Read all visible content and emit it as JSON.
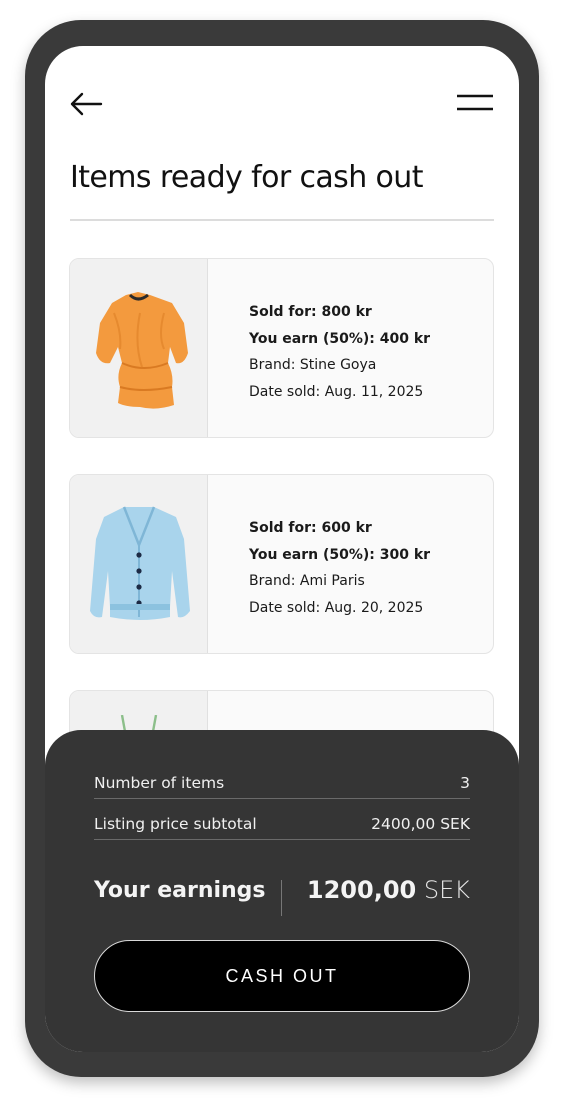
{
  "header": {
    "title": "Items ready for cash out",
    "back_icon": "arrow-left-icon",
    "menu_icon": "hamburger-menu-icon"
  },
  "items": [
    {
      "image": "orange-blouse",
      "sold_for": "Sold for: 800 kr",
      "you_earn": "You earn (50%): 400 kr",
      "brand": "Brand: Stine Goya",
      "date_sold": "Date sold: Aug. 11, 2025"
    },
    {
      "image": "blue-cardigan",
      "sold_for": "Sold for: 600 kr",
      "you_earn": "You earn (50%): 300 kr",
      "brand": "Brand: Ami Paris",
      "date_sold": "Date sold: Aug. 20, 2025"
    },
    {
      "image": "green-garment"
    }
  ],
  "summary": {
    "number_of_items_label": "Number of items",
    "number_of_items_value": "3",
    "subtotal_label": "Listing price subtotal",
    "subtotal_value": "2400,00 SEK",
    "earnings_label": "Your earnings",
    "earnings_amount": "1200,00",
    "earnings_currency": "SEK",
    "cash_out_label": "CASH OUT"
  },
  "colors": {
    "frame": "#3a3a3a",
    "summary_panel": "#353535",
    "button": "#000000",
    "card_bg": "#fafafa",
    "orange_item": "#f39a3e",
    "blue_item": "#a9d4ec"
  }
}
